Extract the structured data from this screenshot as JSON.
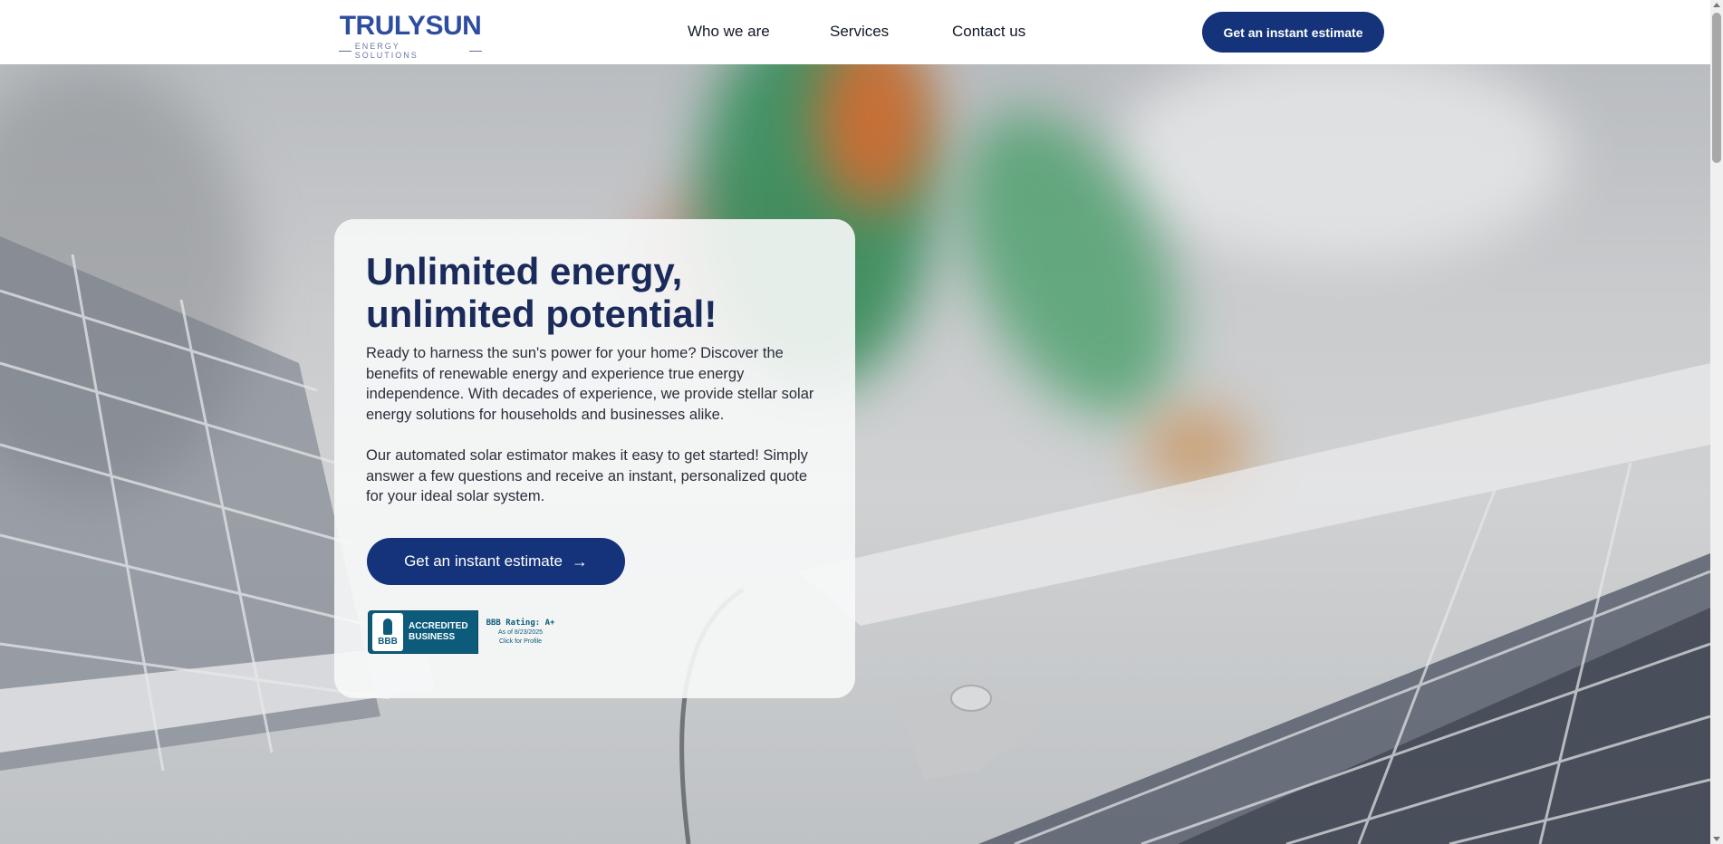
{
  "header": {
    "logo_main": "TRULYSUN",
    "logo_sub": "ENERGY SOLUTIONS",
    "nav": [
      "Who we are",
      "Services",
      "Contact us"
    ],
    "cta_label": "Get an instant estimate"
  },
  "hero": {
    "title_line1": "Unlimited energy,",
    "title_line2": "unlimited potential!",
    "paragraph1": "Ready to harness the sun's power for your home? Discover the benefits of renewable energy and experience true energy independence. With decades of experience, we provide stellar solar energy solutions for households and businesses alike.",
    "paragraph2": "Our automated solar estimator makes it easy to get started! Simply answer a few questions and receive an instant, personalized quote for your ideal solar system.",
    "cta_label": "Get an instant estimate",
    "cta_icon": "arrow-right-icon"
  },
  "bbb_badge": {
    "seal_text": "BBB",
    "accredited_line1": "ACCREDITED",
    "accredited_line2": "BUSINESS",
    "rating": "BBB Rating: A+",
    "as_of": "As of 8/23/2025",
    "click": "Click for Profile"
  },
  "colors": {
    "brand_navy": "#14337a",
    "title_navy": "#1a2a5a",
    "bbb_teal": "#0d5b7a"
  }
}
